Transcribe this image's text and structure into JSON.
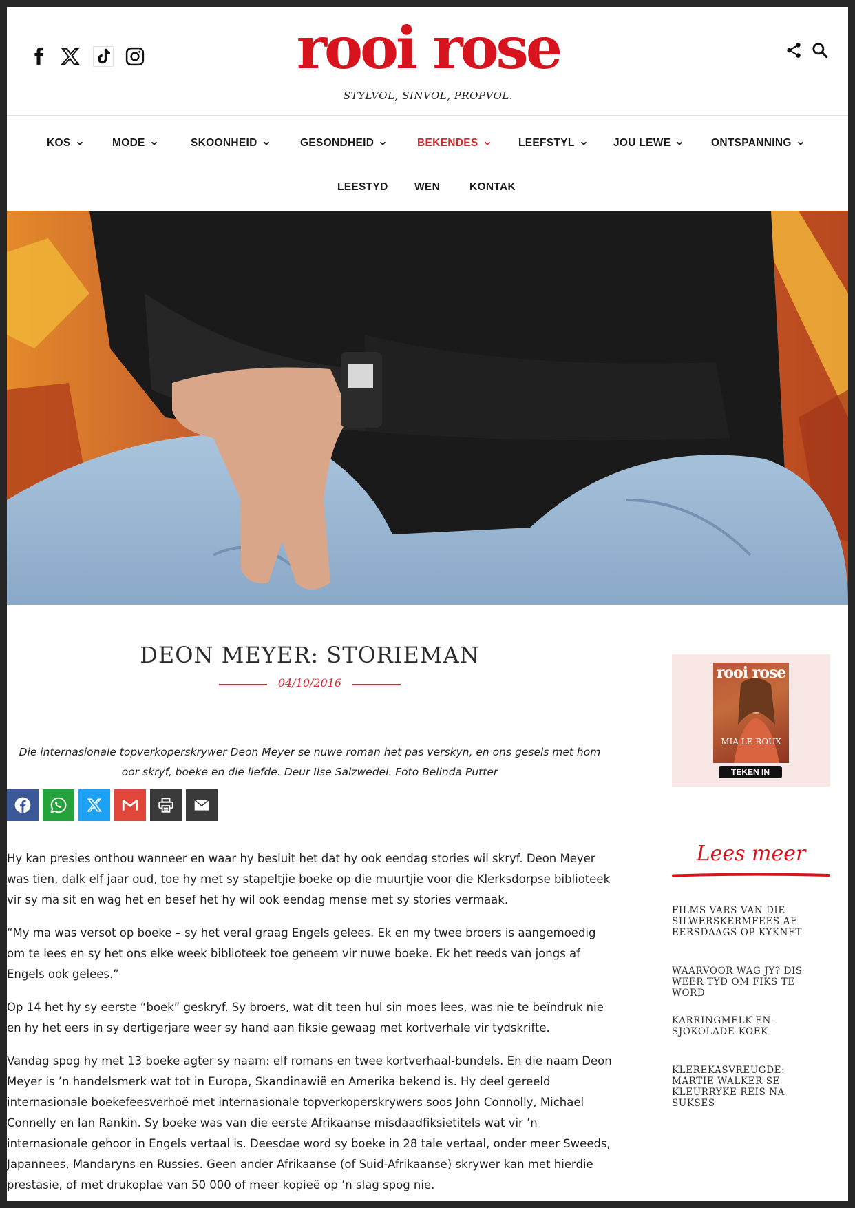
{
  "brand": {
    "logo": "rooi rose",
    "tagline": "STYLVOL, SINVOL, PROPVOL.",
    "accent_color": "#d7131d"
  },
  "header": {
    "social_icons": [
      "facebook-icon",
      "x-icon",
      "tiktok-icon",
      "instagram-icon"
    ],
    "right_icons": [
      "share-icon",
      "search-icon"
    ]
  },
  "nav": {
    "items": [
      {
        "label": "KOS",
        "dropdown": true
      },
      {
        "label": "MODE",
        "dropdown": true
      },
      {
        "label": "SKOONHEID",
        "dropdown": true
      },
      {
        "label": "GESONDHEID",
        "dropdown": true
      },
      {
        "label": "BEKENDES",
        "dropdown": true,
        "active": true
      },
      {
        "label": "LEEFSTYL",
        "dropdown": true
      },
      {
        "label": "JOU LEWE",
        "dropdown": true
      },
      {
        "label": "ONTSPANNING",
        "dropdown": true
      },
      {
        "label": "LEESTYD",
        "dropdown": false
      },
      {
        "label": "WEN",
        "dropdown": false
      },
      {
        "label": "KONTAK",
        "dropdown": false
      }
    ]
  },
  "article": {
    "title": "DEON MEYER: STORIEMAN",
    "date": "04/10/2016",
    "lede": "Die internasionale topverkoperskrywer Deon Meyer se nuwe roman het pas verskyn, en ons gesels met hom oor skryf, boeke en die liefde. Deur Ilse Salzwedel. Foto Belinda Putter",
    "share_buttons": [
      {
        "name": "facebook",
        "color": "#3b5998"
      },
      {
        "name": "whatsapp",
        "color": "#25a33a"
      },
      {
        "name": "x",
        "color": "#1da1f2"
      },
      {
        "name": "gmail",
        "color": "#e0463a"
      },
      {
        "name": "print",
        "color": "#3a3a3a"
      },
      {
        "name": "email",
        "color": "#3a3a3a"
      }
    ],
    "paragraphs": [
      "Hy kan presies onthou wanneer en waar hy besluit het dat hy ook eendag stories wil skryf. Deon Meyer was tien, dalk elf jaar oud, toe hy met sy stapeltjie boeke op die muurtjie voor die Klerksdorpse biblioteek vir sy ma sit en wag het en besef het hy wil ook eendag mense met sy stories vermaak.",
      "“My ma was versot op boeke – sy het veral graag Engels gelees. Ek en my twee broers is aangemoedig om te lees en sy het ons elke week biblioteek toe geneem vir nuwe boeke. Ek het reeds van jongs af Engels ook gelees.”",
      "Op 14 het hy sy eerste “boek” geskryf. Sy broers, wat dit teen hul sin moes lees, was nie te beïndruk nie en hy het eers in sy dertigerjare weer sy hand aan fiksie gewaag met kortverhale vir tydskrifte.",
      "Vandag spog hy met 13 boeke agter sy naam: elf romans en twee kortverhaal-bundels. En die naam Deon Meyer is ’n handelsmerk wat tot in Europa, Skandinawië en Amerika bekend is. Hy deel gereeld internasionale boekefeesverhoë met internasionale topverkoperskrywers soos John Connolly, Michael Connelly en Ian Rankin. Sy boeke was van die eerste Afrikaanse misdaadfiksietitels wat vir ’n internasionale gehoor in Engels vertaal is. Deesdae word sy boeke in 28 tale vertaal, onder meer Sweeds, Japannees, Mandaryns en Russies. Geen ander Afrikaanse (of Suid-Afrikaanse) skrywer kan met hierdie prestasie, of met drukoplae van 50 000 of meer kopieë op ’n slag spog nie."
    ]
  },
  "sidebar": {
    "magazine_logo": "rooi rose",
    "magazine_cover_name": "MIA LE ROUX",
    "subscribe_label": "TEKEN IN",
    "lees_meer": "Lees meer",
    "links": [
      "FILMS VARS VAN DIE SILWERSKERMFEES AF EERSDAAGS OP KYKNET",
      "WAARVOOR WAG JY? DIS WEER TYD OM FIKS TE WORD",
      "KARRINGMELK-EN-SJOKOLADE-KOEK",
      "KLEREKASVREUGDE: MARTIE WALKER SE KLEURRYKE REIS NA SUKSES"
    ]
  }
}
